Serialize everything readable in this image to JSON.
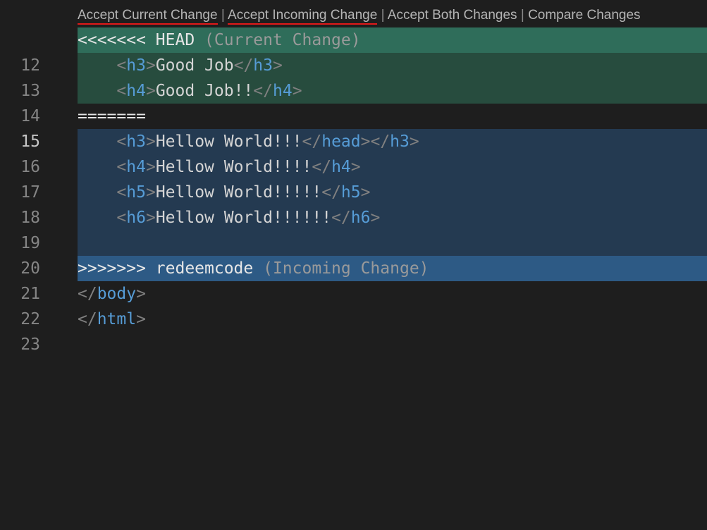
{
  "codelens": {
    "accept_current": "Accept Current Change",
    "accept_incoming": "Accept Incoming Change",
    "accept_both": "Accept Both Changes",
    "compare": "Compare Changes",
    "separator": "|"
  },
  "lines": [
    {
      "num": "12",
      "marker": "<<<<<<< HEAD",
      "annotation": "(Current Change)"
    },
    {
      "num": "13",
      "indent": "    ",
      "open": "h3",
      "text": "Good Job",
      "close": "h3"
    },
    {
      "num": "14",
      "indent": "    ",
      "open": "h4",
      "text": "Good Job!!",
      "close": "h4"
    },
    {
      "num": "15",
      "marker": "======="
    },
    {
      "num": "16",
      "indent": "    ",
      "open": "h3",
      "text": "Hellow World!!!",
      "close_extra": "head",
      "close": "h3"
    },
    {
      "num": "17",
      "indent": "    ",
      "open": "h4",
      "text": "Hellow World!!!!",
      "close": "h4"
    },
    {
      "num": "18",
      "indent": "    ",
      "open": "h5",
      "text": "Hellow World!!!!!",
      "close": "h5"
    },
    {
      "num": "19",
      "indent": "    ",
      "open": "h6",
      "text": "Hellow World!!!!!!",
      "close": "h6"
    },
    {
      "num": "20"
    },
    {
      "num": "21",
      "marker": ">>>>>>> redeemcode",
      "annotation": "(Incoming Change)"
    },
    {
      "num": "22",
      "close": "body"
    },
    {
      "num": "23",
      "close": "html"
    }
  ],
  "colors": {
    "current_header_bg": "#2f6d5a",
    "current_bg": "#274c3e",
    "incoming_bg": "#243a51",
    "incoming_header_bg": "#2d5a85",
    "tag_name": "#569cd6",
    "underline": "#e11919"
  }
}
